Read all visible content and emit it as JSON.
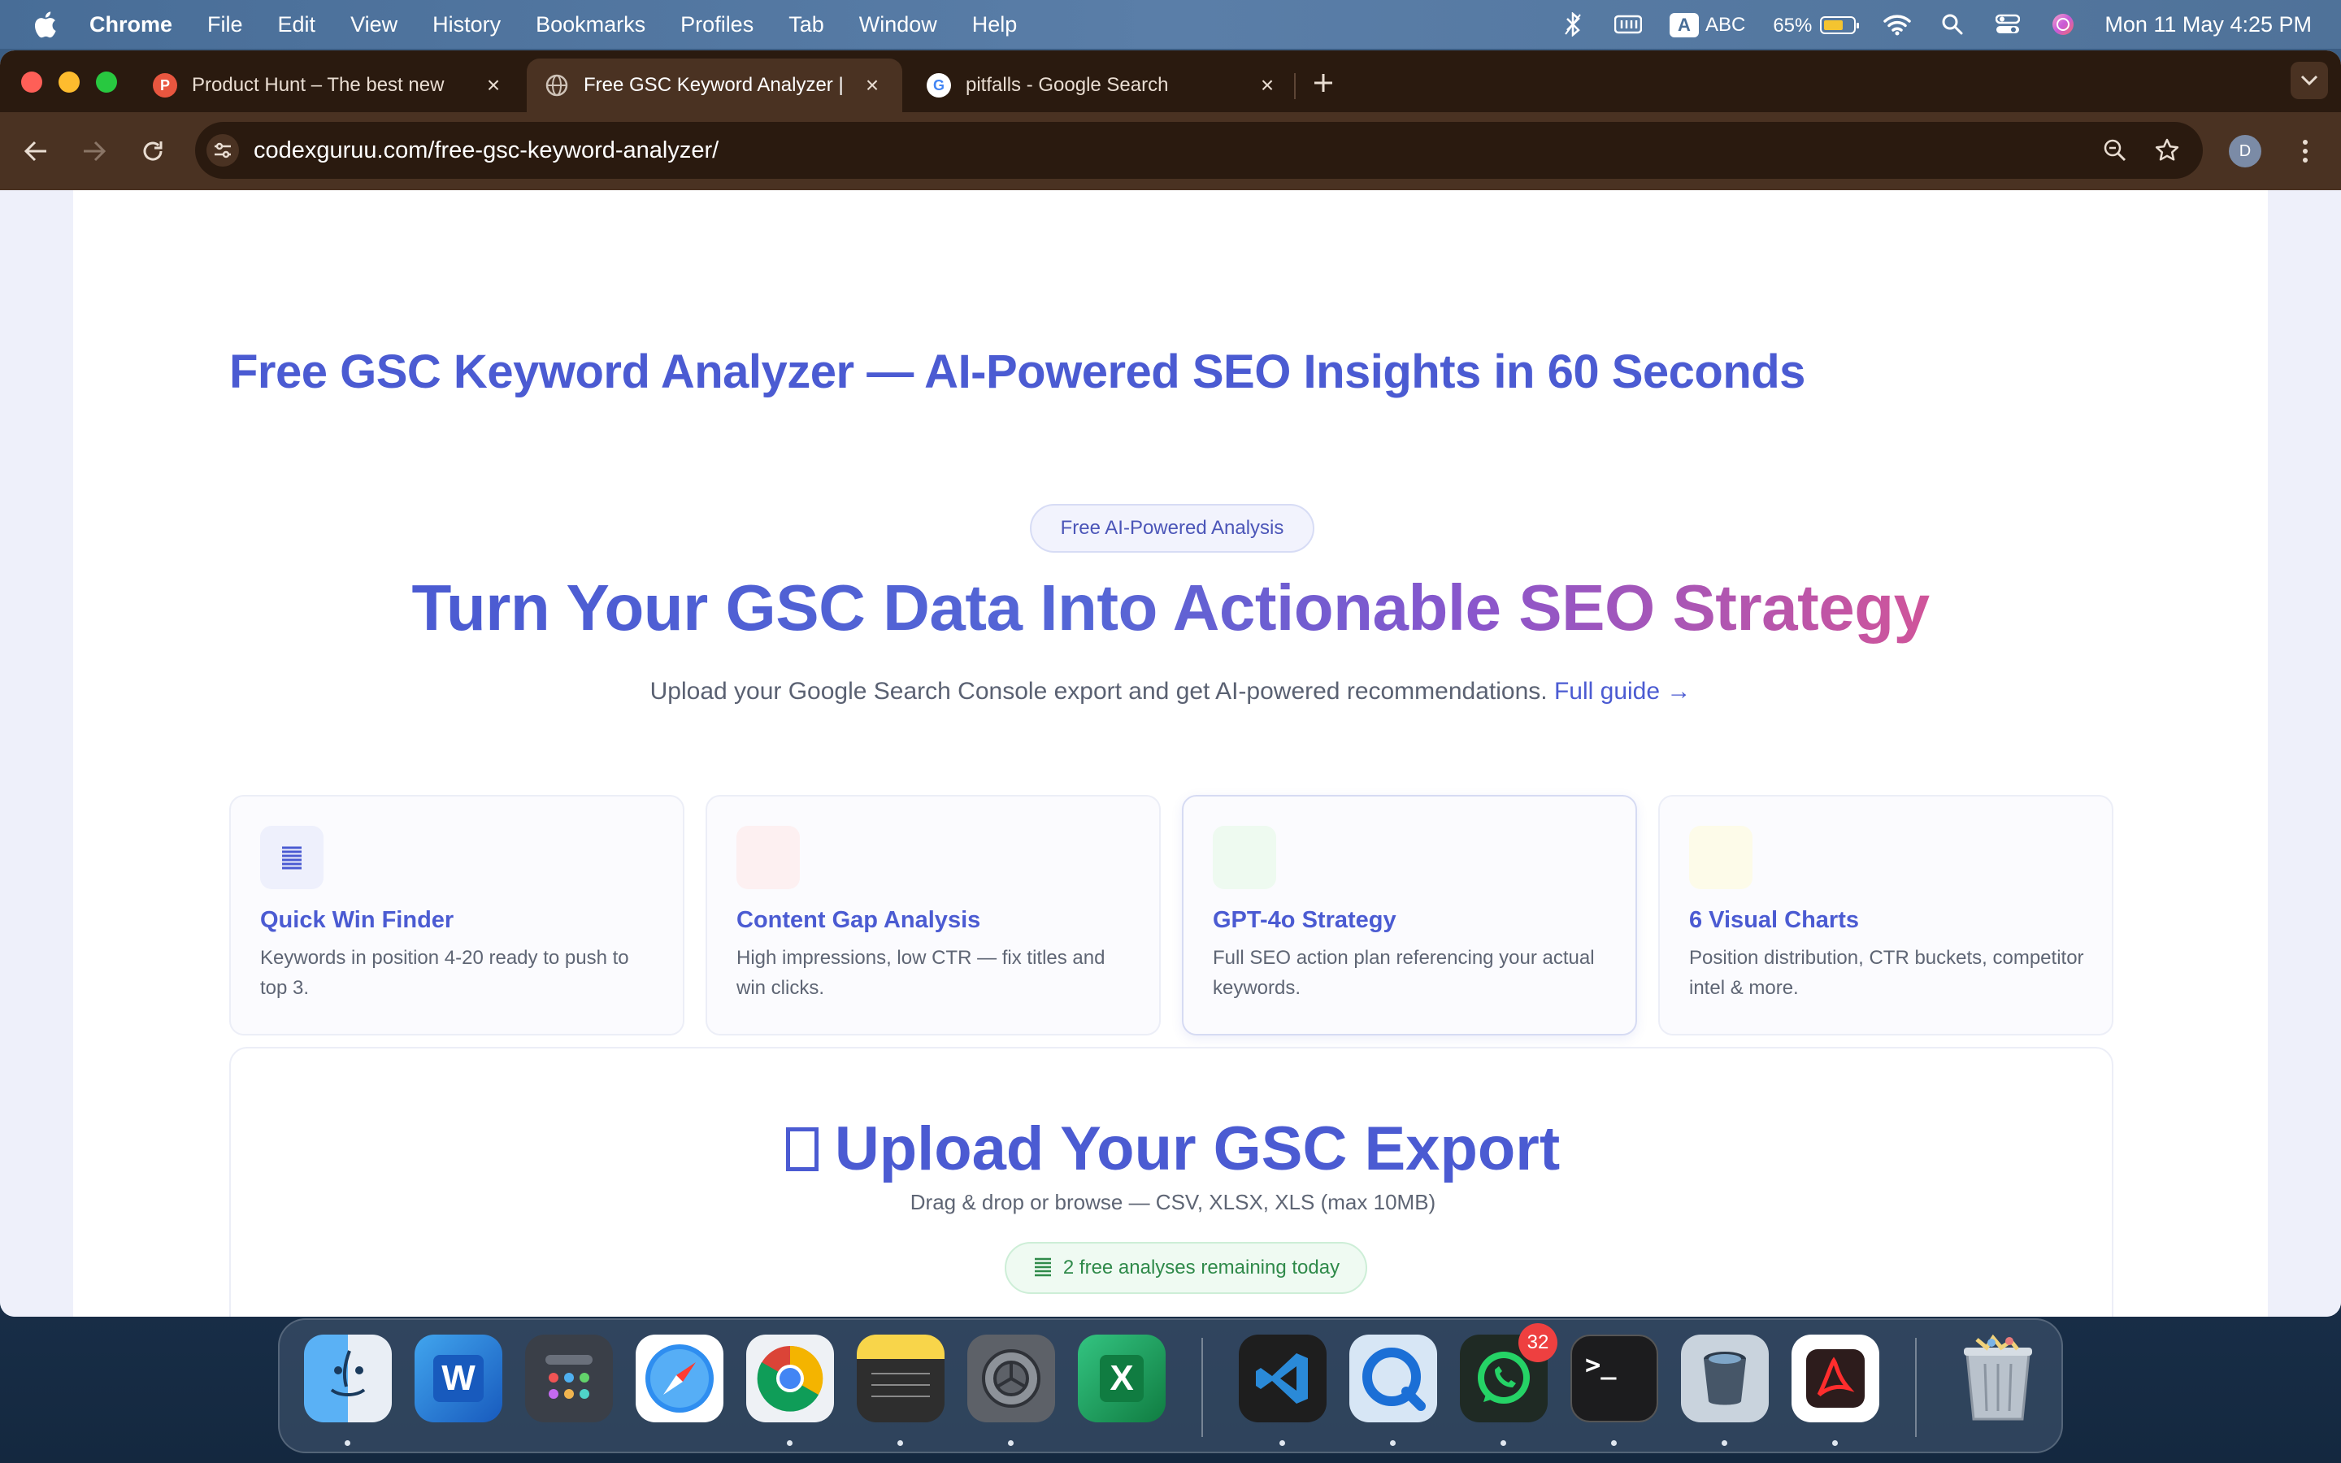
{
  "menubar": {
    "app_name": "Chrome",
    "items": [
      "File",
      "Edit",
      "View",
      "History",
      "Bookmarks",
      "Profiles",
      "Tab",
      "Window",
      "Help"
    ],
    "input_method": "ABC",
    "input_letter": "A",
    "battery_percent": "65%",
    "battery_level": 0.65,
    "datetime": "Mon 11 May  4:25 PM"
  },
  "browser": {
    "tabs": [
      {
        "title": "Product Hunt – The best new",
        "favicon_letter": "P"
      },
      {
        "title": "Free GSC Keyword Analyzer |",
        "favicon_letter": ""
      },
      {
        "title": "pitfalls - Google Search",
        "favicon_letter": "G"
      }
    ],
    "url": "codexguruu.com/free-gsc-keyword-analyzer/",
    "profile_initial": "D"
  },
  "page": {
    "title": "Free GSC Keyword Analyzer — AI-Powered SEO Insights in 60 Seconds",
    "pill": "Free AI-Powered Analysis",
    "hero": "Turn Your GSC Data Into Actionable SEO Strategy",
    "subtitle": "Upload your Google Search Console export and get AI-powered recommendations.",
    "guide_link": "Full guide →",
    "features": [
      {
        "title": "Quick Win Finder",
        "desc": "Keywords in position 4-20 ready to push to top 3.",
        "icon": "document-lines-icon",
        "color": "#eef0fc"
      },
      {
        "title": "Content Gap Analysis",
        "desc": "High impressions, low CTR — fix titles and win clicks.",
        "icon": "blank-icon",
        "color": "#fdf0f1"
      },
      {
        "title": "GPT-4o Strategy",
        "desc": "Full SEO action plan referencing your actual keywords.",
        "icon": "blank-icon",
        "color": "#eefaf0"
      },
      {
        "title": "6 Visual Charts",
        "desc": "Position distribution, CTR buckets, competitor intel & more.",
        "icon": "blank-icon",
        "color": "#fdfbe9"
      }
    ],
    "upload": {
      "title": "Upload Your GSC Export",
      "desc": "Drag & drop or browse — CSV, XLSX, XLS (max 10MB)",
      "remaining": "2 free analyses remaining today"
    }
  },
  "dock": {
    "whatsapp_badge": "32",
    "excel_letter": "X",
    "word_letter": "W",
    "terminal_prompt": ">_"
  }
}
